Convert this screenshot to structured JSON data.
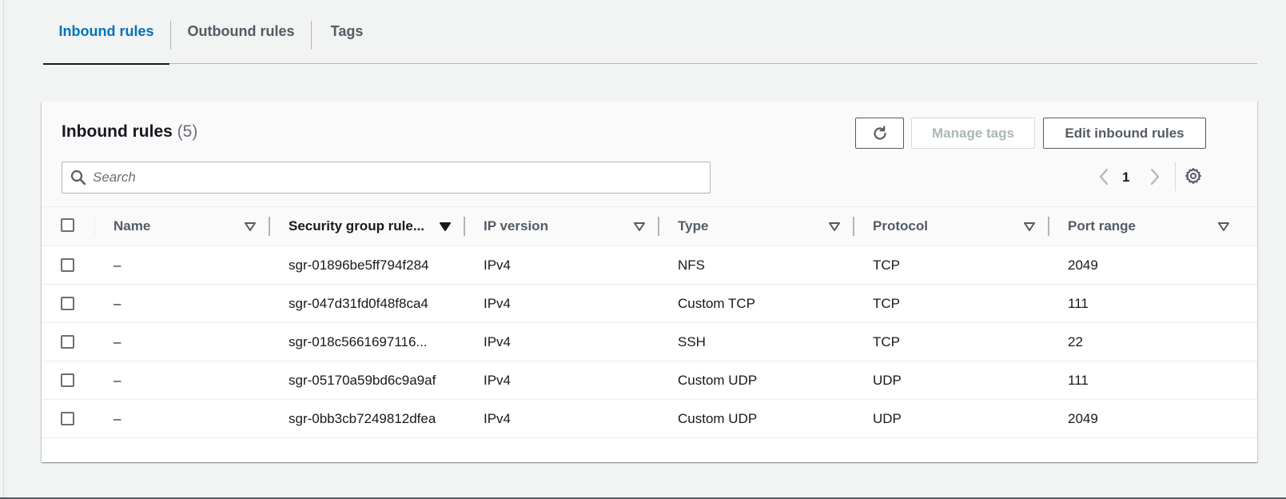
{
  "tabs": [
    "Inbound rules",
    "Outbound rules",
    "Tags"
  ],
  "panel": {
    "title": "Inbound rules",
    "count": "(5)",
    "manage_tags_label": "Manage tags",
    "edit_label": "Edit inbound rules",
    "search_placeholder": "Search",
    "page": "1"
  },
  "table": {
    "columns": [
      "Name",
      "Security group rule...",
      "IP version",
      "Type",
      "Protocol",
      "Port range"
    ],
    "rows": [
      {
        "name": "–",
        "rule_id": "sgr-01896be5ff794f284",
        "ip_version": "IPv4",
        "type": "NFS",
        "protocol": "TCP",
        "port_range": "2049"
      },
      {
        "name": "–",
        "rule_id": "sgr-047d31fd0f48f8ca4",
        "ip_version": "IPv4",
        "type": "Custom TCP",
        "protocol": "TCP",
        "port_range": "111"
      },
      {
        "name": "–",
        "rule_id": "sgr-018c5661697116...",
        "ip_version": "IPv4",
        "type": "SSH",
        "protocol": "TCP",
        "port_range": "22"
      },
      {
        "name": "–",
        "rule_id": "sgr-05170a59bd6c9a9af",
        "ip_version": "IPv4",
        "type": "Custom UDP",
        "protocol": "UDP",
        "port_range": "111"
      },
      {
        "name": "–",
        "rule_id": "sgr-0bb3cb7249812dfea",
        "ip_version": "IPv4",
        "type": "Custom UDP",
        "protocol": "UDP",
        "port_range": "2049"
      }
    ]
  },
  "colors": {
    "accent": "#0073bb",
    "text": "#16191f",
    "muted": "#545b64",
    "disabled": "#aab7b8"
  },
  "icons": [
    "refresh-icon",
    "search-icon",
    "chevron-left-icon",
    "chevron-right-icon",
    "gear-icon",
    "sort-caret-icon"
  ]
}
